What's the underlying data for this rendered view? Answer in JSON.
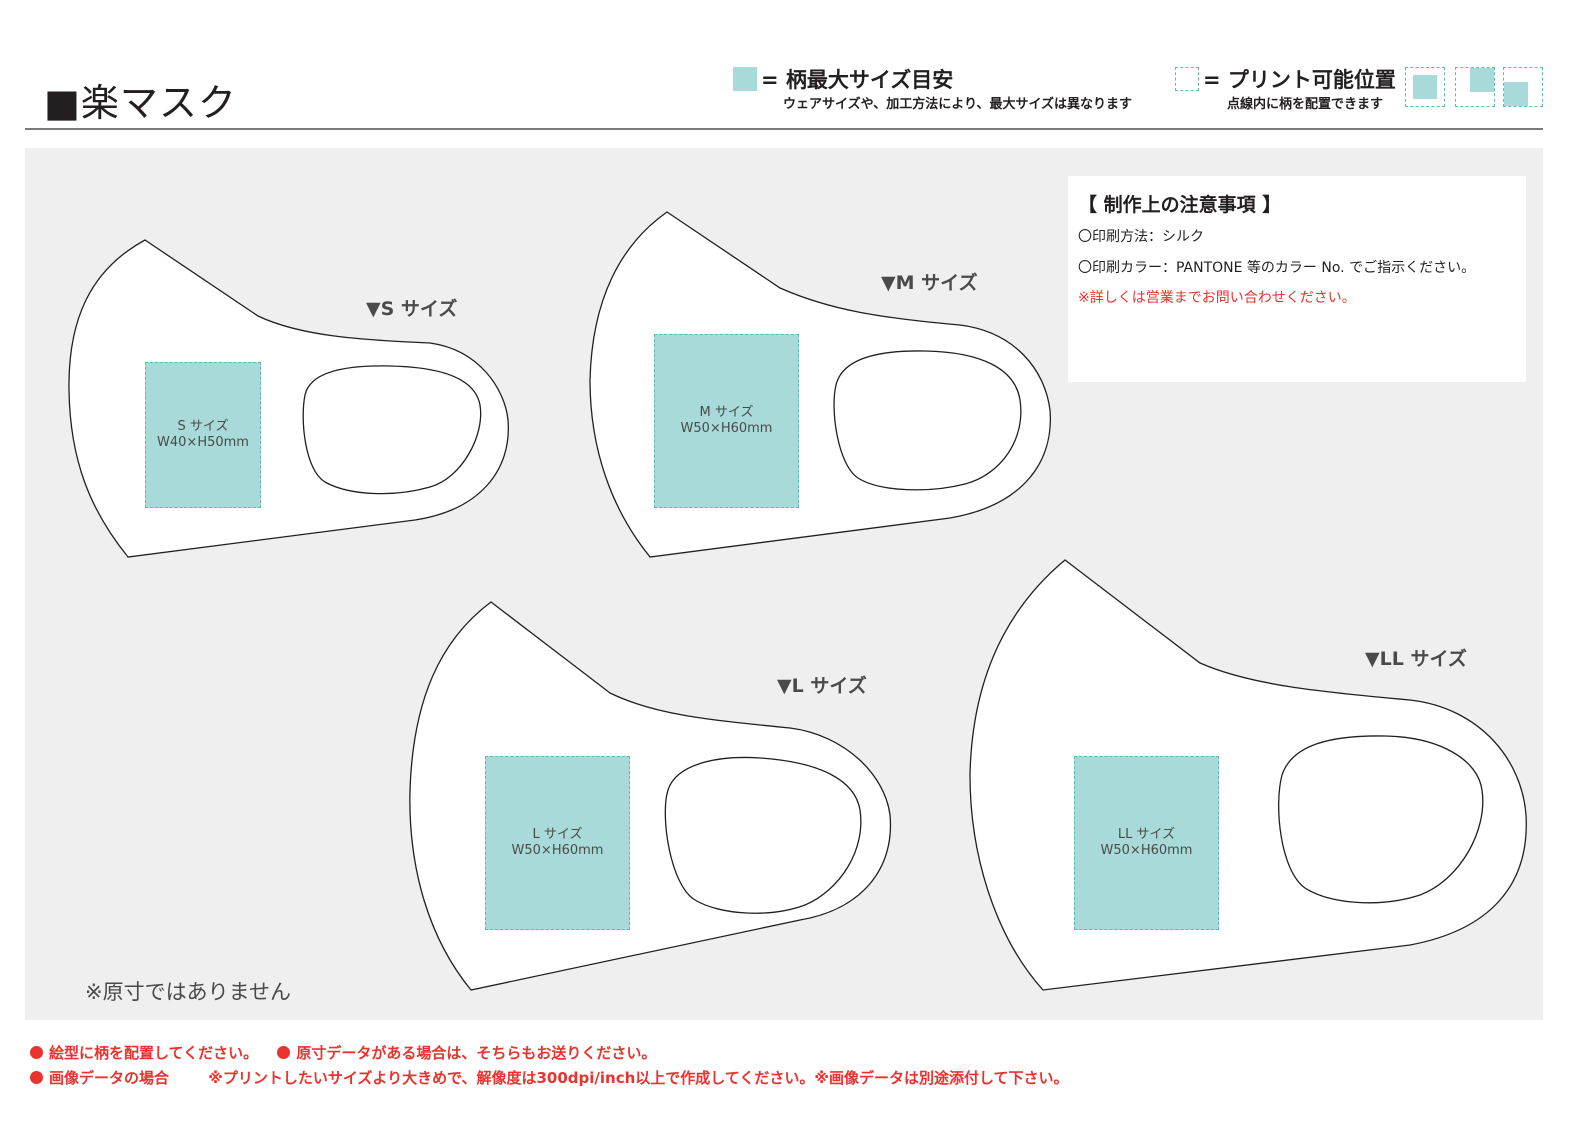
{
  "header": {
    "title": "■楽マスク"
  },
  "legend": {
    "max_size": {
      "head": "= 柄最大サイズ目安",
      "sub": "ウェアサイズや、加工方法により、最大サイズは異なります"
    },
    "print_position": {
      "head": "= プリント可能位置",
      "sub": "点線内に柄を配置できます"
    }
  },
  "notes": {
    "title": "【 制作上の注意事項 】",
    "lines": [
      "〇印刷方法：シルク",
      "〇印刷カラー：PANTONE 等のカラー No. でご指示ください。"
    ],
    "warning": "※詳しくは営業までお問い合わせください。"
  },
  "masks": [
    {
      "label": "▼S サイズ",
      "area_name": "S サイズ",
      "area_size": "W40×H50mm"
    },
    {
      "label": "▼M サイズ",
      "area_name": "M サイズ",
      "area_size": "W50×H60mm"
    },
    {
      "label": "▼L サイズ",
      "area_name": "L サイズ",
      "area_size": "W50×H60mm"
    },
    {
      "label": "▼LL サイズ",
      "area_name": "LL サイズ",
      "area_size": "W50×H60mm"
    }
  ],
  "disclaimer": "※原寸ではありません",
  "footer": {
    "line1_a": "絵型に柄を配置してください。",
    "line1_b": "原寸データがある場合は、そちらもお送りください。",
    "line2_a": "画像データの場合",
    "line2_b": "※プリントしたいサイズより大きめで、解像度は300dpi/inch以上で作成してください。※画像データは別途添付して下さい。"
  },
  "colors": {
    "print_area": "#a8dad9",
    "panel": "#eeefee",
    "warning": "#e8332f"
  }
}
